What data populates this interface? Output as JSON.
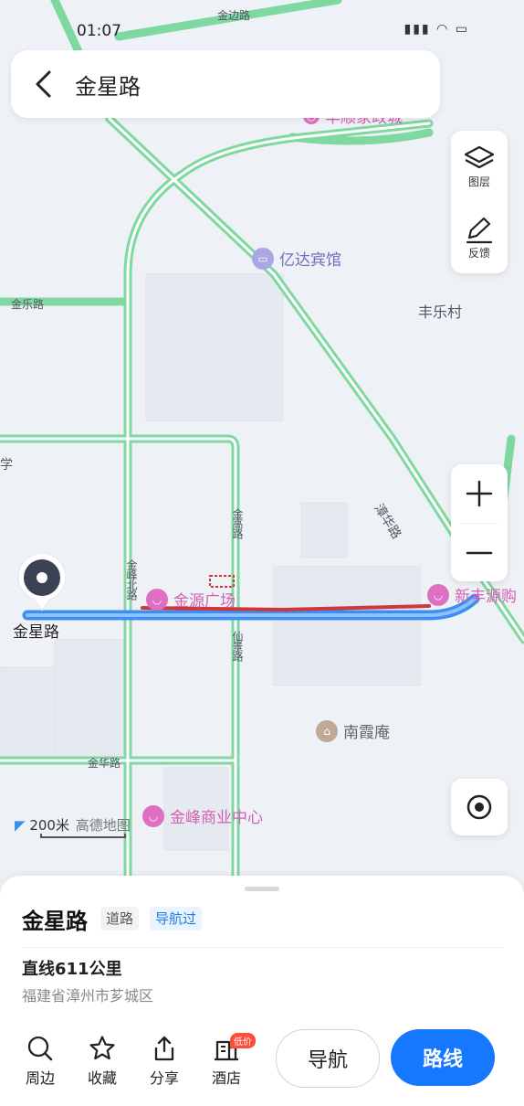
{
  "status_bar": {
    "time": "01:07"
  },
  "search": {
    "title": "金星路"
  },
  "layers": {
    "layer_label": "图层",
    "feedback_label": "反馈"
  },
  "map": {
    "roads": {
      "jinbian": "金边路",
      "jinle": "金乐路",
      "jinfengbei": "金峰北路",
      "jingao": "金高路",
      "xianjing": "仙景路",
      "zhanghua": "漳华路",
      "jinhua": "金华路"
    },
    "places": {
      "fengle": "丰乐村",
      "marker_name": "金星路",
      "left_edge": "学"
    },
    "pois": {
      "yida": "亿达宾馆",
      "jinyuan": "金源广场",
      "xinfengyuan": "新丰源购",
      "nanxia": "南霞庵",
      "jinfeng": "金峰商业中心",
      "top_partial": "丰顺家政城"
    },
    "scale": "200米",
    "provider": "高德地图"
  },
  "sheet": {
    "name": "金星路",
    "tag_type": "道路",
    "tag_nav": "导航过",
    "distance": "直线611公里",
    "address": "福建省漳州市芗城区"
  },
  "actions": {
    "nearby": "周边",
    "favorite": "收藏",
    "share": "分享",
    "hotel": "酒店",
    "hotel_badge": "低价",
    "navigate": "导航",
    "route": "路线"
  },
  "colors": {
    "road_green": "#7fd8a0",
    "route_blue": "#3d8ef2",
    "highlight_red": "#d0363a",
    "poi_pink": "#e06fc4",
    "primary": "#1677ff"
  }
}
